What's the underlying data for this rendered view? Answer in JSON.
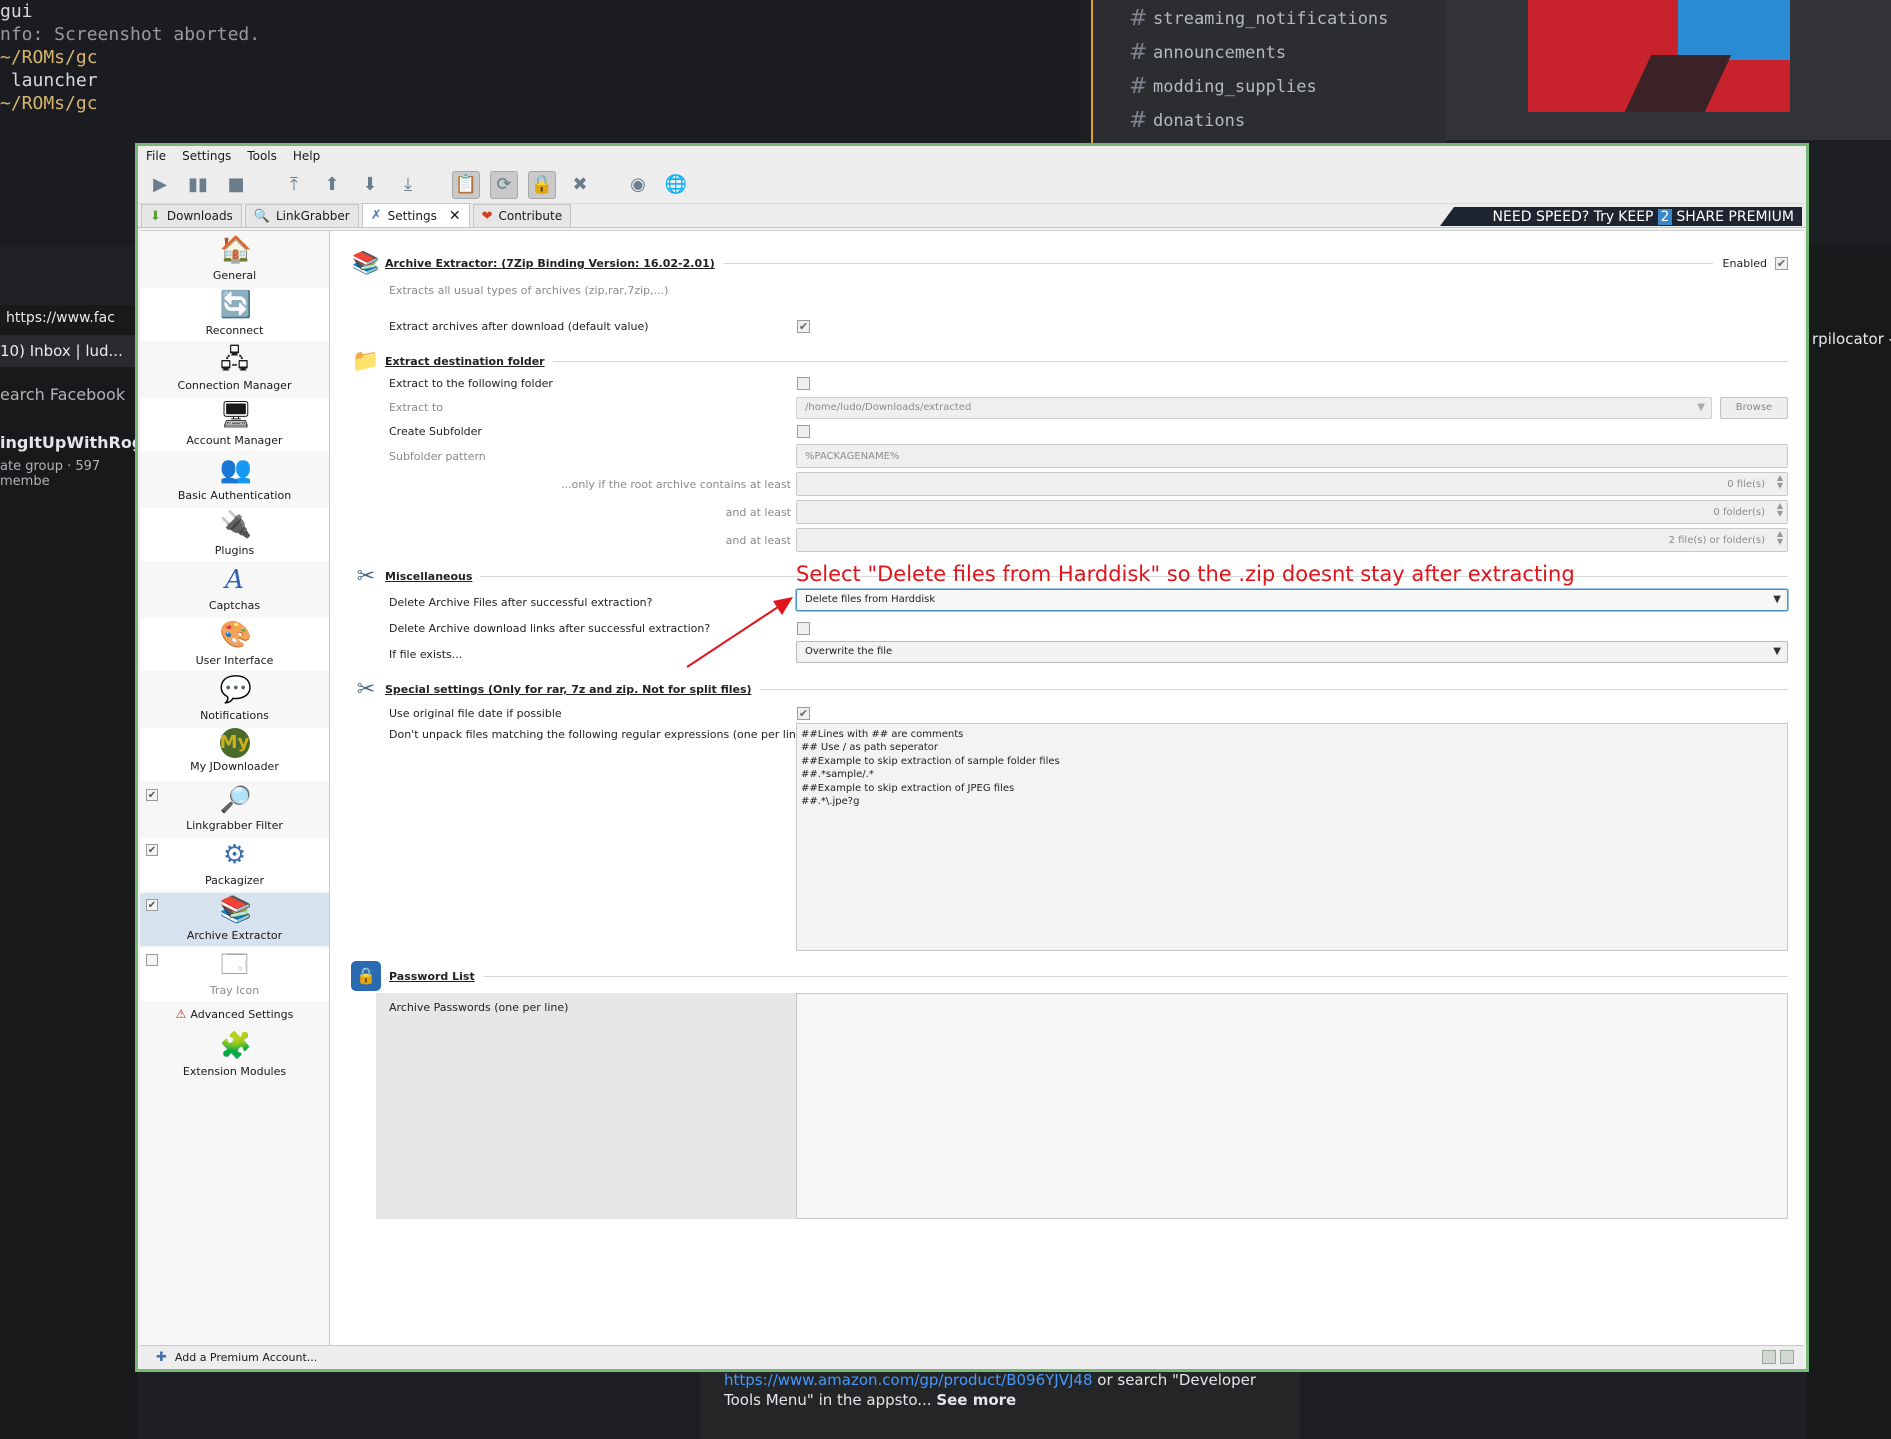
{
  "background": {
    "terminal_lines": [
      {
        "text": "gui",
        "cls": ""
      },
      {
        "text": "nfo: Screenshot aborted.",
        "cls": "dim"
      },
      {
        "text": "~/ROMs/gc",
        "cls": "path"
      },
      {
        "text": " launcher",
        "cls": ""
      },
      {
        "text": "~/ROMs/gc",
        "cls": "path"
      }
    ],
    "discord_channels": [
      "streaming_notifications",
      "announcements",
      "modding_supplies",
      "donations"
    ],
    "browser": {
      "address": "https://www.fac",
      "bookmark": "10) Inbox | lud...",
      "search": "earch Facebook",
      "group_name": "ingItUpWithRoge",
      "group_meta": "ate group · 597 membe"
    },
    "right_bookmark": "rpilocator -",
    "post_link": "https://www.amazon.com/gp/product/B096YJVJ48",
    "post_text": " or search \"Developer Tools Menu\" in the appsto...",
    "post_see_more": "See more"
  },
  "menu": [
    "File",
    "Settings",
    "Tools",
    "Help"
  ],
  "tabs": [
    {
      "label": "Downloads",
      "icon": "download-icon",
      "glyph": "⬇",
      "active": false
    },
    {
      "label": "LinkGrabber",
      "icon": "linkgrabber-icon",
      "glyph": "🔍",
      "active": false
    },
    {
      "label": "Settings",
      "icon": "settings-icon",
      "glyph": "✗",
      "active": true
    },
    {
      "label": "Contribute",
      "icon": "heart-icon",
      "glyph": "❤",
      "active": false
    }
  ],
  "ad": {
    "text1": "NEED SPEED? Try",
    "keep": "KEEP",
    "two": "2",
    "share": "SHARE PREMIUM"
  },
  "sidebar": {
    "items": [
      {
        "label": "General",
        "icon": "house-icon",
        "glyph": "🏠",
        "cb": ""
      },
      {
        "label": "Reconnect",
        "icon": "reconnect-icon",
        "glyph": "🔄",
        "cb": ""
      },
      {
        "label": "Connection Manager",
        "icon": "network-icon",
        "glyph": "🖧",
        "cb": ""
      },
      {
        "label": "Account Manager",
        "icon": "account-icon",
        "glyph": "🖥",
        "cb": ""
      },
      {
        "label": "Basic Authentication",
        "icon": "users-icon",
        "glyph": "👥",
        "cb": ""
      },
      {
        "label": "Plugins",
        "icon": "plugin-icon",
        "glyph": "🔌",
        "cb": ""
      },
      {
        "label": "Captchas",
        "icon": "captcha-icon",
        "glyph": "A",
        "cb": ""
      },
      {
        "label": "User Interface",
        "icon": "ui-icon",
        "glyph": "🎨",
        "cb": ""
      },
      {
        "label": "Notifications",
        "icon": "speech-bubble-icon",
        "glyph": "💬",
        "cb": ""
      },
      {
        "label": "My JDownloader",
        "icon": "myjd-icon",
        "glyph": "My",
        "cb": ""
      },
      {
        "label": "Linkgrabber Filter",
        "icon": "filter-icon",
        "glyph": "🔎",
        "cb": "✔"
      },
      {
        "label": "Packagizer",
        "icon": "packagizer-icon",
        "glyph": "⚙",
        "cb": "✔"
      },
      {
        "label": "Archive Extractor",
        "icon": "archive-icon",
        "glyph": "📚",
        "cb": "✔"
      },
      {
        "label": "Tray Icon",
        "icon": "tray-icon",
        "glyph": "🗔",
        "cb": " "
      }
    ],
    "advanced": "Advanced Settings",
    "advanced_icon": "⚠",
    "extension": "Extension Modules",
    "extension_glyph": "🧩"
  },
  "content": {
    "section1_title": "Archive Extractor: (7Zip Binding Version: 16.02-2.01)",
    "enabled_label": "Enabled",
    "enabled_check": "✔",
    "description": "Extracts all usual types of archives (zip,rar,7zip,...)",
    "extract_after_label": "Extract archives after download (default value)",
    "extract_after_check": "✔",
    "section2_title": "Extract destination folder",
    "extract_to_folder_label": "Extract to the following folder",
    "extract_to_label": "Extract to",
    "extract_to_value": "/home/ludo/Downloads/extracted",
    "browse_label": "Browse",
    "create_subfolder_label": "Create Subfolder",
    "subfolder_pattern_label": "Subfolder pattern",
    "subfolder_pattern_value": "%PACKAGENAME%",
    "only_if_label": "...only if the root archive contains at least",
    "only_if_value": "0 file(s)",
    "and_at_least_1_label": "and at least",
    "and_at_least_1_value": "0 folder(s)",
    "and_at_least_2_label": "and at least",
    "and_at_least_2_value": "2 file(s) or folder(s)",
    "section3_title": "Miscellaneous",
    "delete_files_label": "Delete Archive Files after successful extraction?",
    "delete_files_value": "Delete files from Harddisk",
    "delete_links_label": "Delete Archive download links after successful extraction?",
    "if_exists_label": "If file exists...",
    "if_exists_value": "Overwrite the file",
    "section4_title": "Special settings (Only for rar, 7z and zip. Not for split files)",
    "use_date_label": "Use original file date if possible",
    "use_date_check": "✔",
    "dont_unpack_label": "Don't unpack files matching the following regular expressions (one per line)",
    "regex_text": "##Lines with ## are comments\n## Use / as path seperator\n##Example to skip extraction of sample folder files\n##.*sample/.*\n##Example to skip extraction of JPEG files\n##.*\\.jpe?g",
    "section5_title": "Password List",
    "passwords_label": "Archive Passwords (one per line)"
  },
  "annotation": "Select \"Delete files from Harddisk\" so the .zip doesnt stay after extracting",
  "status": {
    "add_premium": "Add a Premium Account..."
  }
}
